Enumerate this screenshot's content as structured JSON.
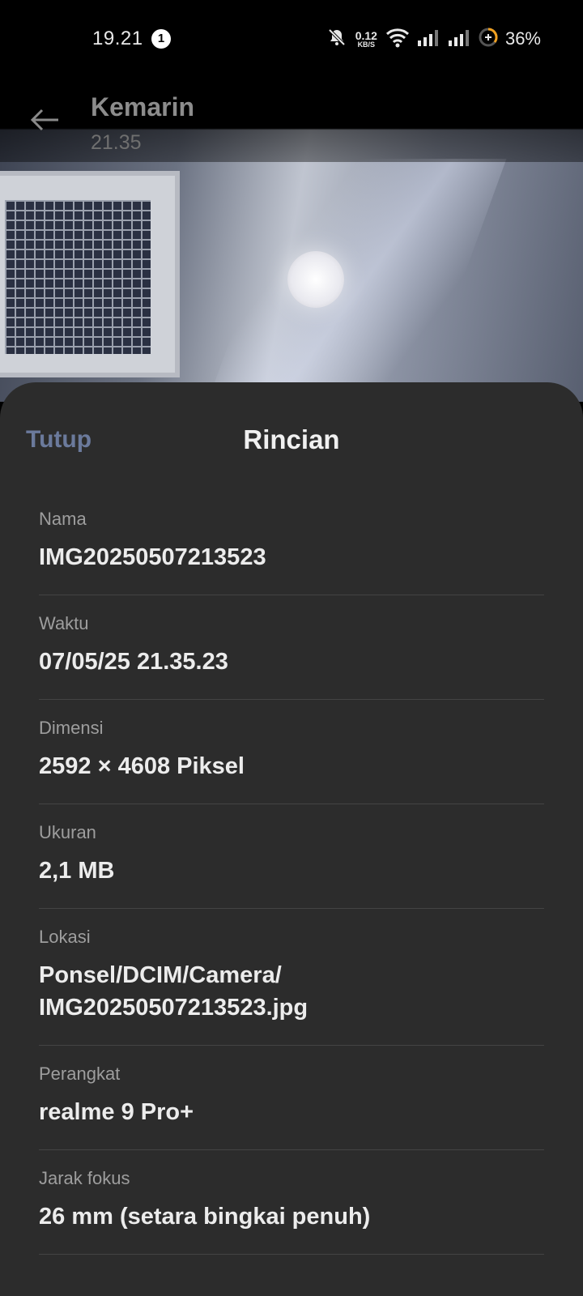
{
  "status_bar": {
    "time": "19.21",
    "notification_count": "1",
    "net_speed_value": "0.12",
    "net_speed_unit": "KB/S",
    "battery_percent": "36%",
    "icons": [
      "mute-icon",
      "wifi-icon",
      "signal-icon",
      "signal-icon",
      "battery-icon"
    ]
  },
  "header": {
    "title": "Kemarin",
    "subtitle": "21.35"
  },
  "sheet": {
    "close_label": "Tutup",
    "title": "Rincian",
    "details": [
      {
        "label": "Nama",
        "value": "IMG20250507213523"
      },
      {
        "label": "Waktu",
        "value": "07/05/25 21.35.23"
      },
      {
        "label": "Dimensi",
        "value": "2592 × 4608 Piksel"
      },
      {
        "label": "Ukuran",
        "value": "2,1 MB"
      },
      {
        "label": "Lokasi",
        "value": "Ponsel/DCIM/Camera/\nIMG20250507213523.jpg"
      },
      {
        "label": "Perangkat",
        "value": "realme 9 Pro+"
      },
      {
        "label": "Jarak fokus",
        "value": "26 mm (setara bingkai penuh)"
      }
    ]
  },
  "colors": {
    "sheet_background": "#2c2c2c",
    "close_accent": "#6b7a9c",
    "divider": "#444444"
  }
}
